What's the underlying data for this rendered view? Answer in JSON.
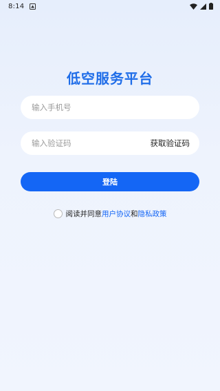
{
  "status_bar": {
    "time": "8:14",
    "icons": [
      "notification-icon",
      "wifi-icon",
      "signal-icon",
      "battery-icon"
    ]
  },
  "app": {
    "title": "低空服务平台"
  },
  "phone": {
    "placeholder": "输入手机号",
    "value": ""
  },
  "code": {
    "placeholder": "输入验证码",
    "value": "",
    "get_code_label": "获取验证码"
  },
  "login": {
    "label": "登陆"
  },
  "agreement": {
    "prefix": "阅读并同意",
    "user_agreement": "用户协议",
    "conjunction": "和",
    "privacy_policy": "隐私政策",
    "checked": false
  },
  "colors": {
    "accent": "#1466f5",
    "title": "#1f6de8",
    "background": "#eaf0fc"
  }
}
